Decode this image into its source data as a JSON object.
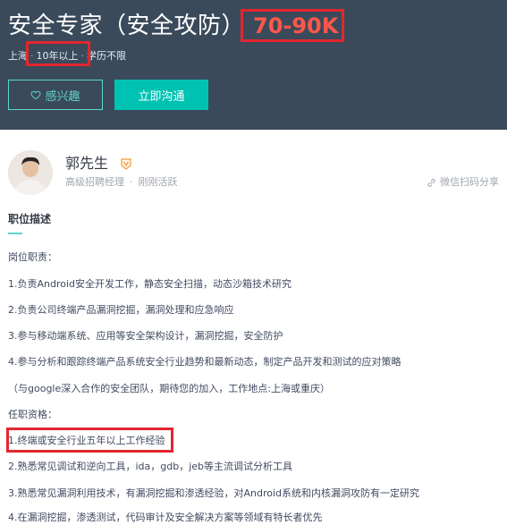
{
  "header": {
    "title": "安全专家（安全攻防）",
    "salary": "70-90K",
    "city": "上海",
    "experience": "10年以上",
    "education": "学历不限",
    "separator": "·",
    "interest_label": "感兴趣",
    "chat_label": "立即沟通"
  },
  "recruiter": {
    "name": "郭先生",
    "title": "高级招聘经理",
    "separator": "·",
    "status": "刚刚活跃",
    "share_label": "微信扫码分享"
  },
  "description": {
    "section_title": "职位描述",
    "lines": [
      "岗位职责：",
      "1.负责Android安全开发工作，静态安全扫描，动态沙箱技术研究",
      "2.负责公司终端产品漏洞挖掘，漏洞处理和应急响应",
      "3.参与移动端系统、应用等安全架构设计，漏洞挖掘，安全防护",
      "4.参与分析和跟踪终端产品系统安全行业趋势和最新动态，制定产品开发和测试的应对策略",
      "（与google深入合作的安全团队，期待您的加入，工作地点:上海或重庆）",
      "任职资格：",
      "1.终端或安全行业五年以上工作经验",
      "2.熟悉常见调试和逆向工具，ida，gdb，jeb等主流调试分析工具",
      "3.熟悉常见漏洞利用技术，有漏洞挖掘和渗透经验，对Android系统和内核漏洞攻防有一定研究",
      "4.在漏洞挖掘，渗透测试，代码审计及安全解决方案等领域有特长者优先"
    ]
  },
  "colors": {
    "header_bg": "#3a4a5b",
    "accent": "#00c2b3",
    "salary": "#fe574a",
    "highlight_box": "#e3262e"
  }
}
